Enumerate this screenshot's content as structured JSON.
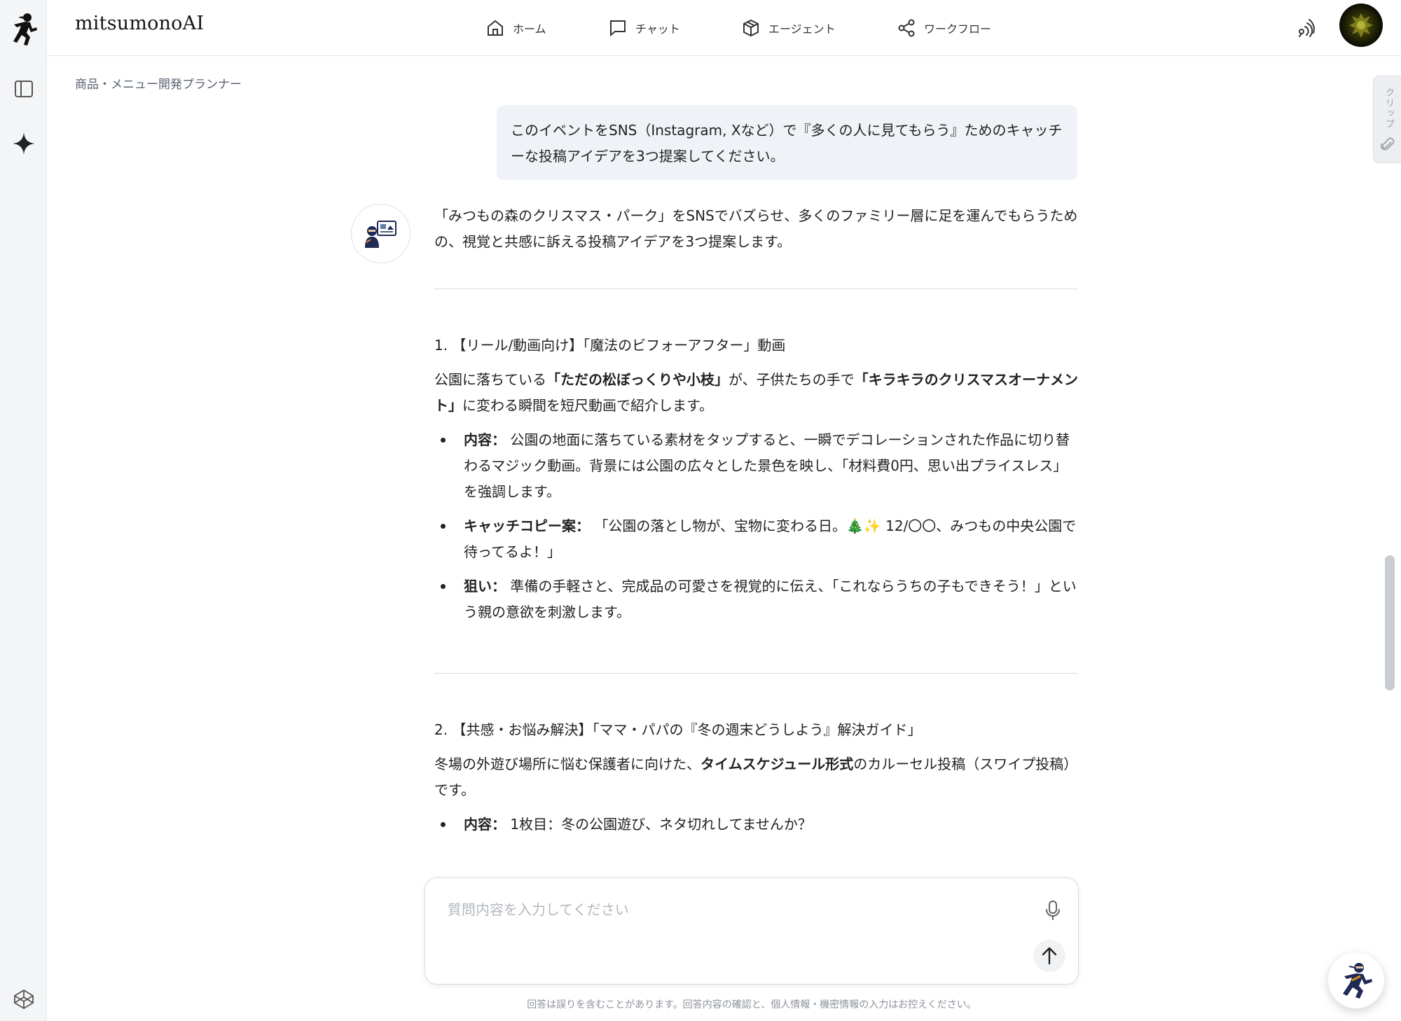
{
  "header": {
    "brand": "mitsumonoAI",
    "nav": [
      {
        "label": "ホーム",
        "icon": "home-icon"
      },
      {
        "label": "チャット",
        "icon": "chat-icon"
      },
      {
        "label": "エージェント",
        "icon": "agent-cube-icon"
      },
      {
        "label": "ワークフロー",
        "icon": "share-nodes-icon"
      }
    ]
  },
  "breadcrumb": "商品・メニュー開発プランナー",
  "clip_tab": {
    "label": "クリップ"
  },
  "user_message": "このイベントをSNS（Instagram, Xなど）で『多くの人に見てもらう』ためのキャッチーな投稿アイデアを3つ提案してください。",
  "answer": {
    "intro": "「みつもの森のクリスマス・パーク」をSNSでバズらせ、多くのファミリー層に足を運んでもらうための、視覚と共感に訴える投稿アイデアを3つ提案します。",
    "idea1": {
      "title": "1. 【リール/動画向け】「魔法のビフォーアフター」動画",
      "desc_pre": "公園に落ちている",
      "desc_bold1": "「ただの松ぼっくりや小枝」",
      "desc_mid": "が、子供たちの手で",
      "desc_bold2": "「キラキラのクリスマスオーナメント」",
      "desc_post": "に変わる瞬間を短尺動画で紹介します。",
      "bullets": [
        {
          "label": "内容：",
          "text": " 公園の地面に落ちている素材をタップすると、一瞬でデコレーションされた作品に切り替わるマジック動画。背景には公園の広々とした景色を映し、「材料費0円、思い出プライスレス」を強調します。"
        },
        {
          "label": "キャッチコピー案：",
          "text": " 「公園の落とし物が、宝物に変わる日。🎄✨ 12/〇〇、みつもの中央公園で待ってるよ！」"
        },
        {
          "label": "狙い：",
          "text": " 準備の手軽さと、完成品の可愛さを視覚的に伝え、「これならうちの子もできそう！」という親の意欲を刺激します。"
        }
      ]
    },
    "idea2": {
      "title": "2. 【共感・お悩み解決】「ママ・パパの『冬の週末どうしよう』解決ガイド」",
      "desc_pre": "冬場の外遊び場所に悩む保護者に向けた、",
      "desc_bold1": "タイムスケジュール形式",
      "desc_post": "のカルーセル投稿（スワイプ投稿）です。",
      "bullets": [
        {
          "label": "内容：",
          "text": " 1枚目：冬の公園遊び、ネタ切れしてませんか？"
        }
      ]
    }
  },
  "input": {
    "placeholder": "質問内容を入力してください",
    "value": ""
  },
  "disclaimer": "回答は誤りを含むことがあります。回答内容の確認と、個人情報・機密情報の入力はお控えください。",
  "colors": {
    "accent": "#1f2a55",
    "bubble": "#eff2f6",
    "rail": "#f4f5f7"
  }
}
